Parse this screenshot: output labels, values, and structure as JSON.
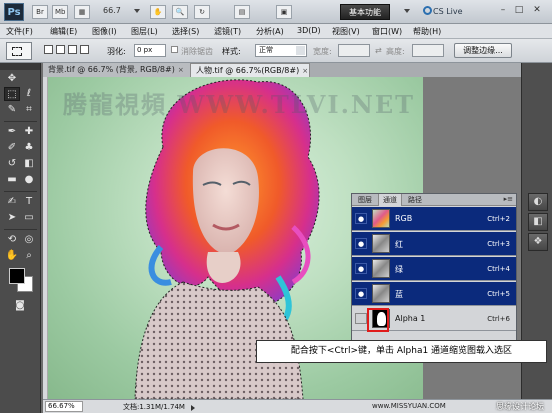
{
  "titlebar": {
    "app_logo": "Ps",
    "br": "Br",
    "mb": "Mb",
    "zoom": "66.7",
    "workspace": "基本功能",
    "cslive": "CS Live"
  },
  "menu": [
    "文件(F)",
    "编辑(E)",
    "图像(I)",
    "图层(L)",
    "选择(S)",
    "滤镜(T)",
    "分析(A)",
    "3D(D)",
    "视图(V)",
    "窗口(W)",
    "帮助(H)"
  ],
  "options": {
    "feather_label": "羽化:",
    "feather_value": "0 px",
    "antialias_label": "消除锯齿",
    "style_label": "样式:",
    "style_value": "正常",
    "width_label": "宽度:",
    "height_label": "高度:",
    "refine_edge": "调整边缘..."
  },
  "documents": {
    "back_tab": "背景.tif @ 66.7% (背景, RGB/8#)",
    "back_close": "×",
    "front_tab": "人物.tif @ 66.7%(RGB/8#)",
    "front_close": "×",
    "watermark": "腾龍視頻 WWW.TLVI.NET"
  },
  "channels_panel": {
    "tabs": [
      "图层",
      "通道",
      "路径"
    ],
    "menu_icon": "▸≡",
    "rows": [
      {
        "name": "RGB",
        "shortcut": "Ctrl+2",
        "selected": true,
        "eye": "●"
      },
      {
        "name": "红",
        "shortcut": "Ctrl+3",
        "selected": true,
        "eye": "●"
      },
      {
        "name": "绿",
        "shortcut": "Ctrl+4",
        "selected": true,
        "eye": "●"
      },
      {
        "name": "蓝",
        "shortcut": "Ctrl+5",
        "selected": true,
        "eye": "●"
      },
      {
        "name": "Alpha 1",
        "shortcut": "Ctrl+6",
        "selected": false,
        "eye": ""
      }
    ]
  },
  "caption": "配合按下<Ctrl>键，单击 Alpha1 通道缩览图载入选区",
  "statusbar": {
    "zoom": "66.67%",
    "doc_size": "文档:1.31M/1.74M",
    "credit": "思缘设计论坛",
    "credit_url": "www.MISSYUAN.COM"
  }
}
